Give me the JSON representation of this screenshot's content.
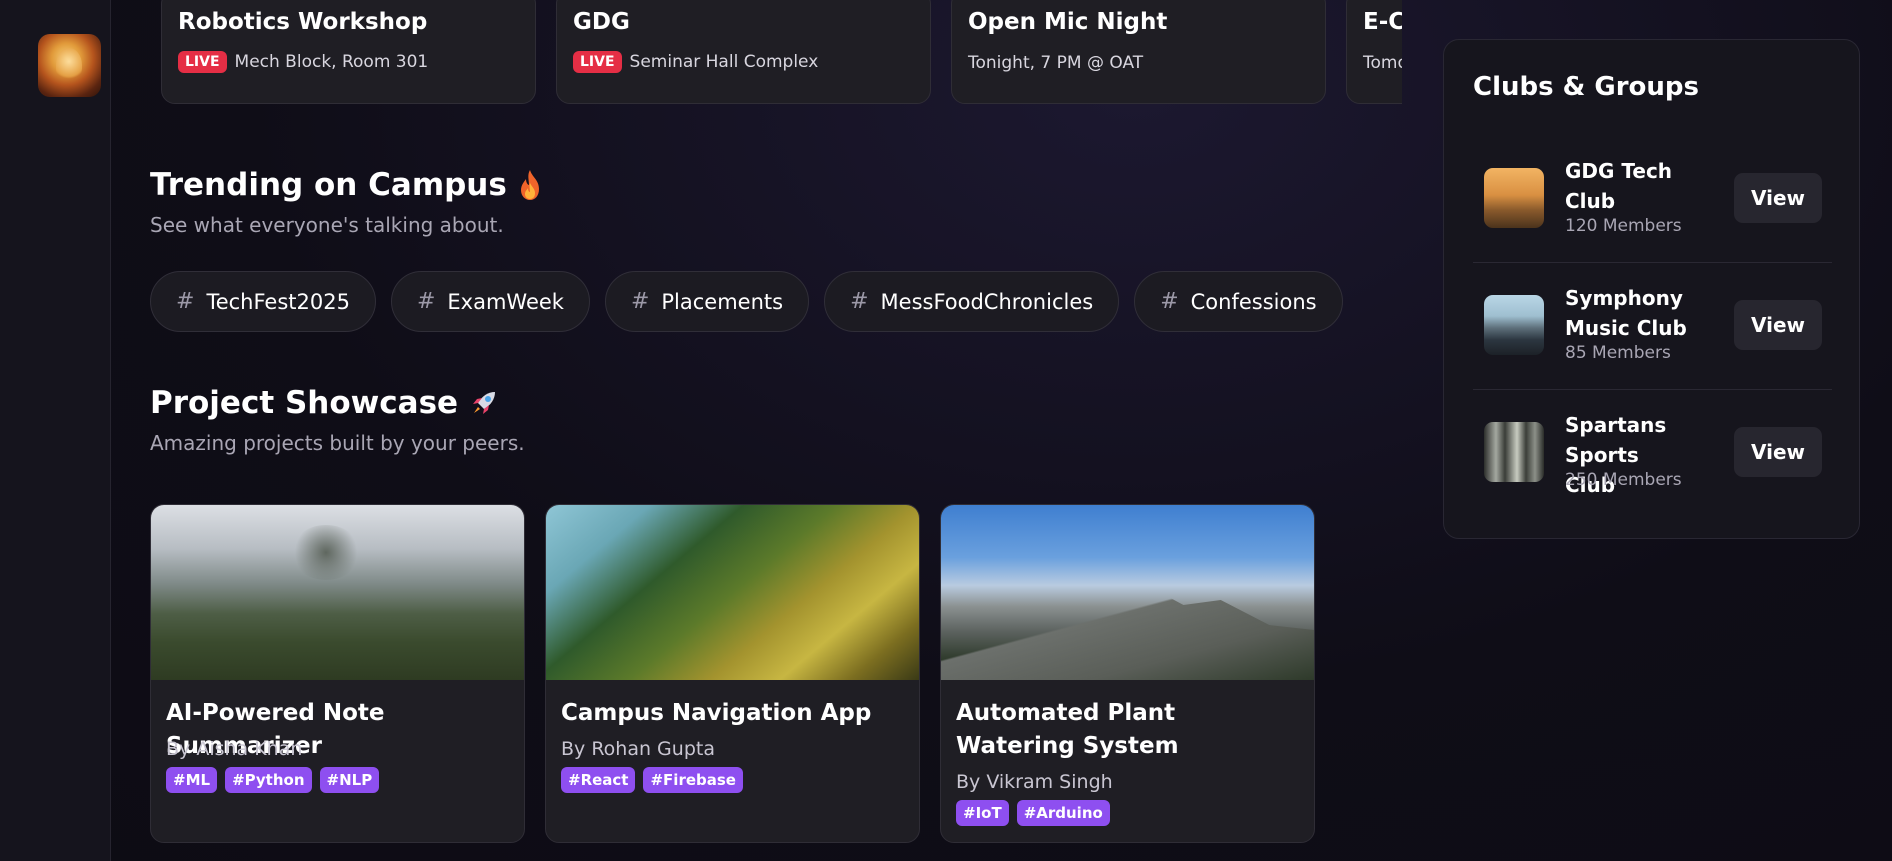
{
  "events": [
    {
      "title": "Robotics Workshop",
      "live": true,
      "live_label": "LIVE",
      "location": "Mech Block, Room 301"
    },
    {
      "title": "GDG",
      "live": true,
      "live_label": "LIVE",
      "location": "Seminar Hall Complex"
    },
    {
      "title": "Open Mic Night",
      "live": false,
      "location": "Tonight, 7 PM @ OAT"
    },
    {
      "title": "E-C",
      "live": false,
      "location": "Tomo"
    }
  ],
  "trending": {
    "title": "Trending on Campus",
    "subtitle": "See what everyone's talking about.",
    "hashtags": [
      "TechFest2025",
      "ExamWeek",
      "Placements",
      "MessFoodChronicles",
      "Confessions"
    ]
  },
  "showcase": {
    "title": "Project Showcase",
    "subtitle": "Amazing projects built by your peers.",
    "projects": [
      {
        "title": "AI-Powered Note Summarizer",
        "author": "By Aisha Khan",
        "tags": [
          "#ML",
          "#Python",
          "#NLP"
        ]
      },
      {
        "title": "Campus Navigation App",
        "author": "By Rohan Gupta",
        "tags": [
          "#React",
          "#Firebase"
        ]
      },
      {
        "title": "Automated Plant Watering System",
        "author": "By Vikram Singh",
        "tags": [
          "#IoT",
          "#Arduino"
        ]
      }
    ]
  },
  "clubs": {
    "title": "Clubs & Groups",
    "view_label": "View",
    "items": [
      {
        "name": "GDG Tech Club",
        "members": "120 Members"
      },
      {
        "name": "Symphony Music Club",
        "members": "85 Members"
      },
      {
        "name": "Spartans Sports Club",
        "members": "250 Members"
      }
    ]
  },
  "icons": {
    "hash": "#",
    "fire": "fire-icon",
    "rocket": "rocket-icon"
  },
  "colors": {
    "accent": "#8e4ff0",
    "live": "#e52e45",
    "background": "#0f0d17"
  }
}
